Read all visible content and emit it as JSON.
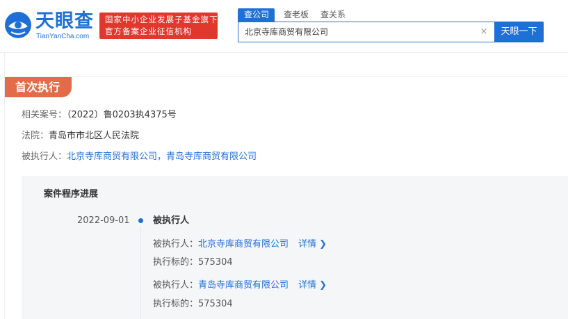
{
  "header": {
    "logo_text": "天眼查",
    "logo_sub": "TianYanCha.com",
    "badge_line1": "国家中小企业发展子基金旗下",
    "badge_line2": "官方备案企业征信机构",
    "tabs": [
      {
        "label": "查公司"
      },
      {
        "label": "查老板"
      },
      {
        "label": "查关系"
      }
    ],
    "search_value": "北京寺库商贸有限公司",
    "clear_symbol": "×",
    "search_button": "天眼一下"
  },
  "section": {
    "tag": "首次执行",
    "case_label": "相关案号：",
    "case_value": "（2022）鲁0203执4375号",
    "court_label": "法院：",
    "court_value": "青岛市市北区人民法院",
    "executed_label": "被执行人：",
    "executed_value": "北京寺库商贸有限公司，青岛寺库商贸有限公司"
  },
  "progress": {
    "title": "案件程序进展",
    "entries": [
      {
        "date": "2022-09-01",
        "heading": "被执行人",
        "items": [
          {
            "label": "被执行人：",
            "company": "北京寺库商贸有限公司",
            "detail": "详情 ❯",
            "amount_label": "执行标的：",
            "amount": "575304"
          },
          {
            "label": "被执行人：",
            "company": "青岛寺库商贸有限公司",
            "detail": "详情 ❯",
            "amount_label": "执行标的：",
            "amount": "575304"
          }
        ]
      }
    ]
  },
  "colors": {
    "brand_blue": "#1f70d6",
    "badge_red": "#e1382e",
    "tag_orange": "#e46b4a"
  }
}
